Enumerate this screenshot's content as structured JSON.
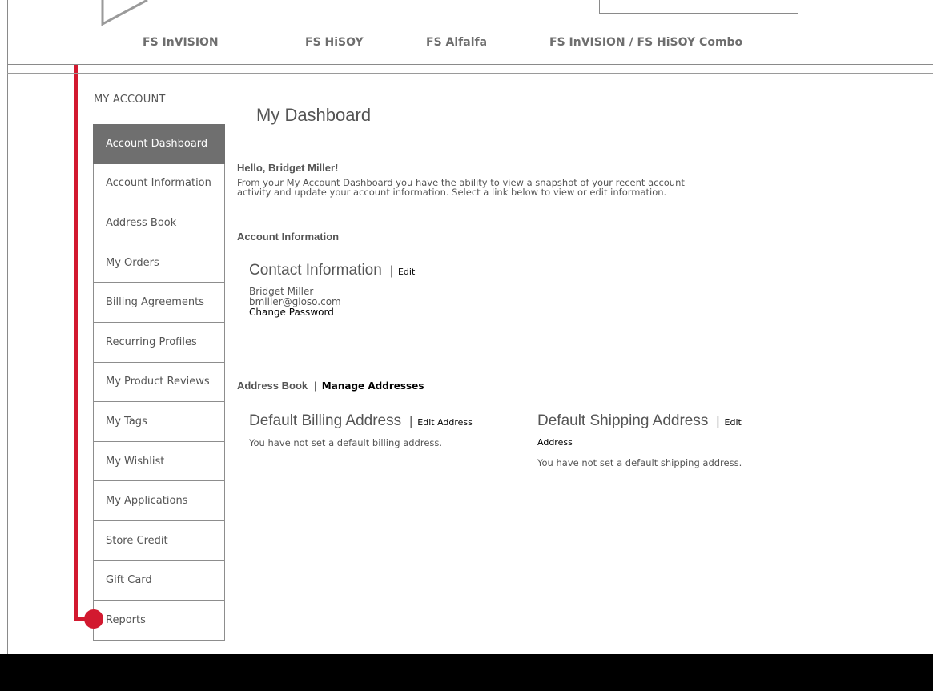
{
  "header": {
    "nav": [
      {
        "label": "FS InVISION"
      },
      {
        "label": "FS HiSOY"
      },
      {
        "label": "FS Alfalfa"
      },
      {
        "label": "FS InVISION / FS HiSOY Combo"
      }
    ]
  },
  "sidebar": {
    "title": "MY ACCOUNT",
    "items": [
      {
        "label": "Account Dashboard",
        "active": true
      },
      {
        "label": "Account Information"
      },
      {
        "label": "Address Book"
      },
      {
        "label": "My Orders"
      },
      {
        "label": "Billing Agreements"
      },
      {
        "label": "Recurring Profiles"
      },
      {
        "label": "My Product Reviews"
      },
      {
        "label": "My Tags"
      },
      {
        "label": "My Wishlist"
      },
      {
        "label": "My Applications"
      },
      {
        "label": "Store Credit"
      },
      {
        "label": "Gift Card"
      },
      {
        "label": "Reports"
      }
    ]
  },
  "main": {
    "title": "My Dashboard",
    "greeting": "Hello, Bridget Miller!",
    "intro_line1": "From your My Account Dashboard you have the ability to view a snapshot of your recent account",
    "intro_line2": "activity and update your account information. Select a link below to view or edit information.",
    "account_info": {
      "heading": "Account Information",
      "contact_heading": "Contact Information",
      "pipe": "|",
      "edit_label": "Edit",
      "name": "Bridget Miller",
      "email": "bmiller@gloso.com",
      "change_password": "Change Password"
    },
    "address_book": {
      "heading": "Address Book",
      "pipe": "|",
      "manage_label": "Manage Addresses",
      "billing": {
        "heading": "Default Billing Address",
        "edit_label": "Edit Address",
        "message": "You have not set a default billing address."
      },
      "shipping": {
        "heading": "Default Shipping Address",
        "edit_label": "Edit",
        "edit_label_wrap": "Address",
        "message": "You have not set a default shipping address."
      }
    }
  },
  "colors": {
    "accent_annotation": "#d2192f",
    "active_nav_bg": "#6f6f6f",
    "footer": "#000000"
  }
}
